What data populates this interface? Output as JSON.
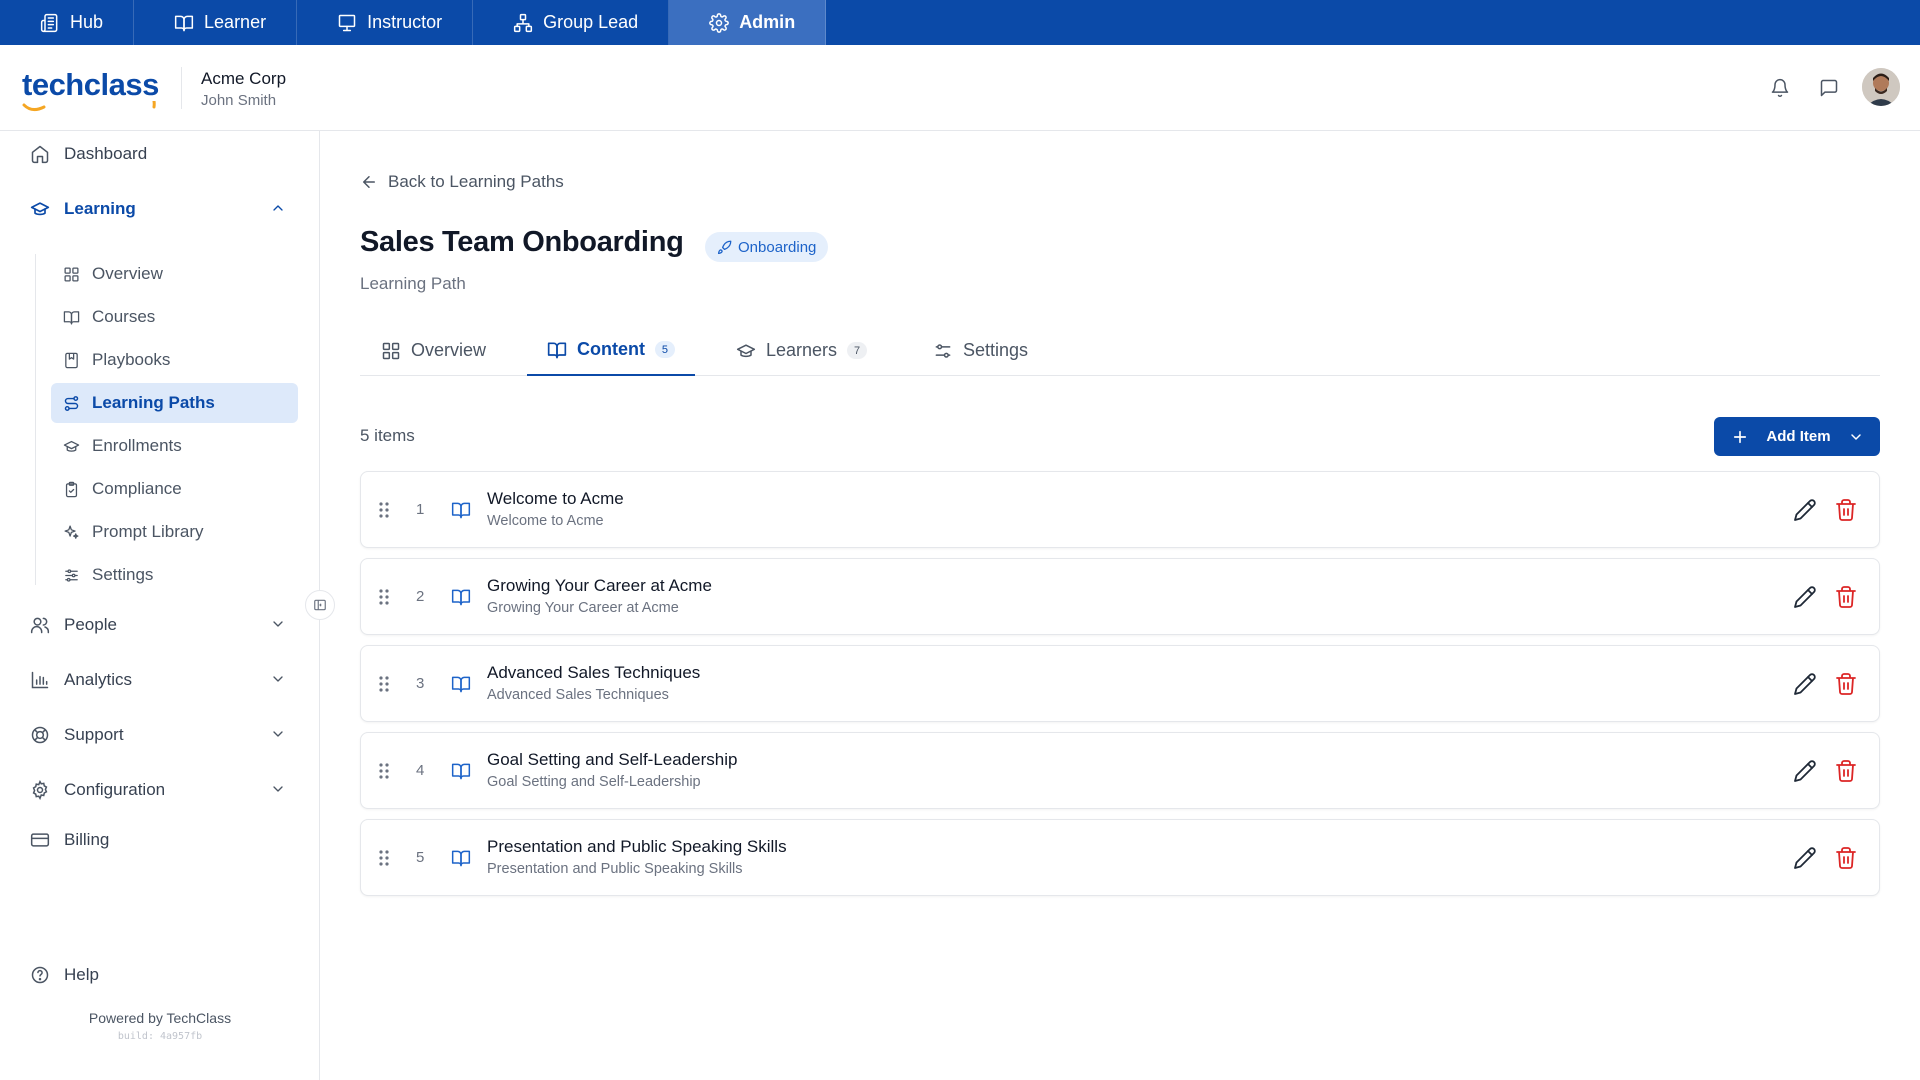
{
  "roles": [
    {
      "label": "Hub",
      "icon": "newspaper-icon"
    },
    {
      "label": "Learner",
      "icon": "book-icon"
    },
    {
      "label": "Instructor",
      "icon": "presentation-icon"
    },
    {
      "label": "Group Lead",
      "icon": "org-chart-icon"
    },
    {
      "label": "Admin",
      "icon": "gear-icon",
      "active": true
    }
  ],
  "header": {
    "logo_text": "techclass",
    "org_name": "Acme Corp",
    "user_name": "John Smith"
  },
  "sidebar": {
    "dashboard": "Dashboard",
    "learning": "Learning",
    "learning_items": [
      "Overview",
      "Courses",
      "Playbooks",
      "Learning Paths",
      "Enrollments",
      "Compliance",
      "Prompt Library",
      "Settings"
    ],
    "active_item": "Learning Paths",
    "people": "People",
    "analytics": "Analytics",
    "support": "Support",
    "configuration": "Configuration",
    "billing": "Billing",
    "help": "Help",
    "powered_by": "Powered by TechClass",
    "build": "build: 4a957fb"
  },
  "main": {
    "back_label": "Back to Learning Paths",
    "title": "Sales Team Onboarding",
    "tag": "Onboarding",
    "subtitle": "Learning Path",
    "tabs": [
      {
        "label": "Overview",
        "count": null
      },
      {
        "label": "Content",
        "count": "5",
        "active": true
      },
      {
        "label": "Learners",
        "count": "7"
      },
      {
        "label": "Settings",
        "count": null
      }
    ],
    "items_count": "5 items",
    "add_button": "Add Item",
    "items": [
      {
        "index": "1",
        "title": "Welcome to Acme",
        "subtitle": "Welcome to Acme"
      },
      {
        "index": "2",
        "title": "Growing Your Career at Acme",
        "subtitle": "Growing Your Career at Acme"
      },
      {
        "index": "3",
        "title": "Advanced Sales Techniques",
        "subtitle": "Advanced Sales Techniques"
      },
      {
        "index": "4",
        "title": "Goal Setting and Self-Leadership",
        "subtitle": "Goal Setting and Self-Leadership"
      },
      {
        "index": "5",
        "title": "Presentation and Public Speaking Skills",
        "subtitle": "Presentation and Public Speaking Skills"
      }
    ]
  },
  "colors": {
    "brand": "#0b4aa8",
    "accent_orange": "#f5a623",
    "delete_red": "#dc2626",
    "active_bg": "#dde9fa"
  }
}
